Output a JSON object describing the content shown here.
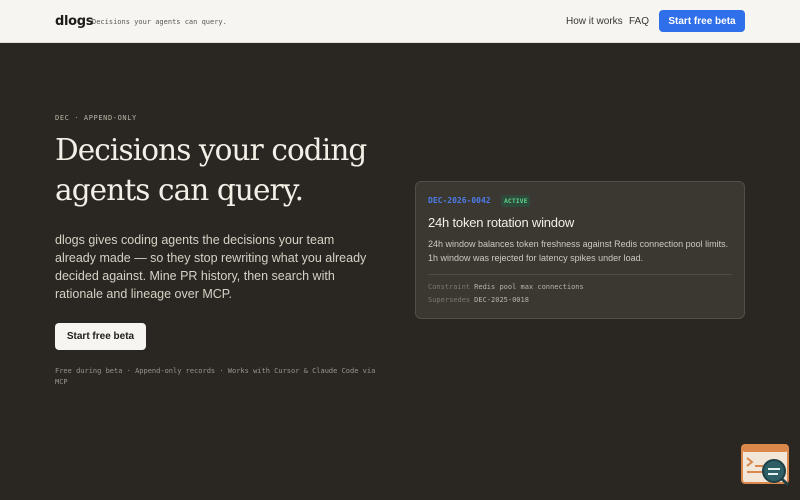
{
  "header": {
    "logo": "dlogs",
    "tagline": "Decisions your agents can query.",
    "nav": [
      "How it works",
      "FAQ"
    ],
    "cta_label": "Start free beta"
  },
  "hero": {
    "eyebrow": "DEC · APPEND-ONLY",
    "headline": "Decisions your coding agents can query.",
    "description": "dlogs gives coding agents the decisions your team already made — so they stop rewriting what you already decided against. Mine PR history, then search with rationale and lineage over MCP.",
    "cta_label": "Start free beta",
    "footnote": "Free during beta · Append-only records · Works with Cursor & Claude Code via MCP"
  },
  "card": {
    "id": "DEC-2026-0042",
    "status": "ACTIVE",
    "title": "24h token rotation window",
    "body": "24h window balances token freshness against Redis connection pool limits. 1h window was rejected for latency spikes under load.",
    "meta": [
      {
        "key": "Constraint",
        "value": "Redis pool max connections"
      },
      {
        "key": "Supersedes",
        "value": "DEC-2025-0018"
      }
    ]
  },
  "colors": {
    "background": "#2a2722",
    "header_bg": "#f6f5f1",
    "accent_blue": "#2f6fea",
    "status_green": "#5cd08a",
    "widget_orange": "#d9874a"
  },
  "icons": {
    "widget": "terminal-search-icon"
  }
}
